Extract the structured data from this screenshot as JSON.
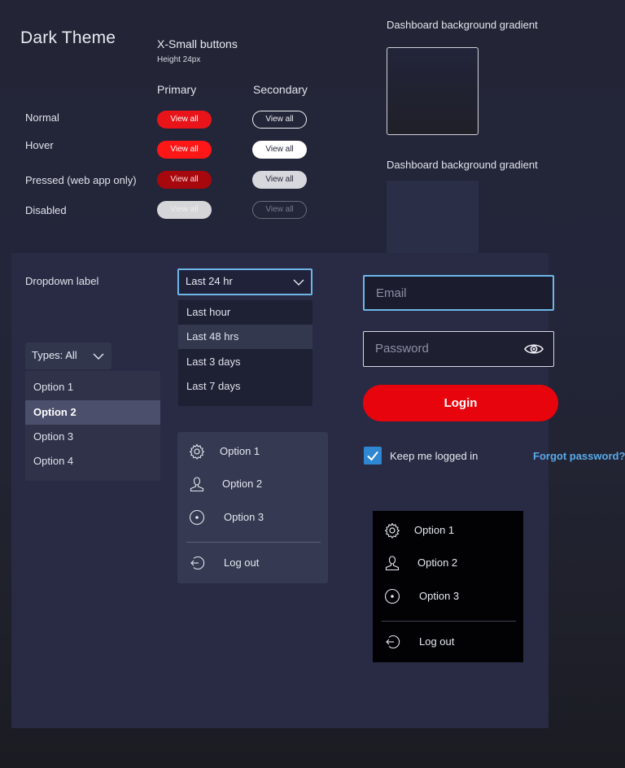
{
  "page": {
    "title": "Dark Theme",
    "xsmall_heading": "X-Small buttons",
    "xsmall_height_note": "Height 24px",
    "primary_heading": "Primary",
    "secondary_heading": "Secondary"
  },
  "states": [
    "Normal",
    "Hover",
    "Pressed (web app only)",
    "Disabled"
  ],
  "buttons": {
    "primary_label": "View all",
    "secondary_label": "View all"
  },
  "gradients": {
    "title1": "Dashboard background gradient",
    "title2": "Dashboard background gradient"
  },
  "dropdown": {
    "label": "Dropdown label",
    "selected": "Last 24 hr",
    "options": [
      "Last hour",
      "Last 48 hrs",
      "Last 3 days",
      "Last 7 days"
    ],
    "highlighted_index": 1
  },
  "types_dropdown": {
    "selected": "Types: All",
    "options": [
      "Option 1",
      "Option 2",
      "Option 3",
      "Option 4"
    ],
    "highlighted_index": 1
  },
  "menu_light": {
    "items": [
      {
        "label": "Option 1",
        "icon": "gear-icon"
      },
      {
        "label": "Option 2",
        "icon": "user-icon"
      },
      {
        "label": "Option 3",
        "icon": "disc-icon"
      }
    ],
    "logout": {
      "label": "Log out",
      "icon": "logout-icon"
    }
  },
  "menu_dark": {
    "items": [
      {
        "label": "Option 1",
        "icon": "gear-icon"
      },
      {
        "label": "Option 2",
        "icon": "user-icon"
      },
      {
        "label": "Option 3",
        "icon": "disc-icon"
      }
    ],
    "logout": {
      "label": "Log out",
      "icon": "logout-icon"
    }
  },
  "login_form": {
    "email_placeholder": "Email",
    "password_placeholder": "Password",
    "login_label": "Login",
    "keep_logged_in": "Keep me logged in",
    "keep_logged_in_checked": true,
    "forgot_password": "Forgot password?"
  },
  "colors": {
    "primary": "#e8141a",
    "accent_blue": "#6fb6e8",
    "link": "#5aa9ea",
    "panel": "#282b43"
  }
}
